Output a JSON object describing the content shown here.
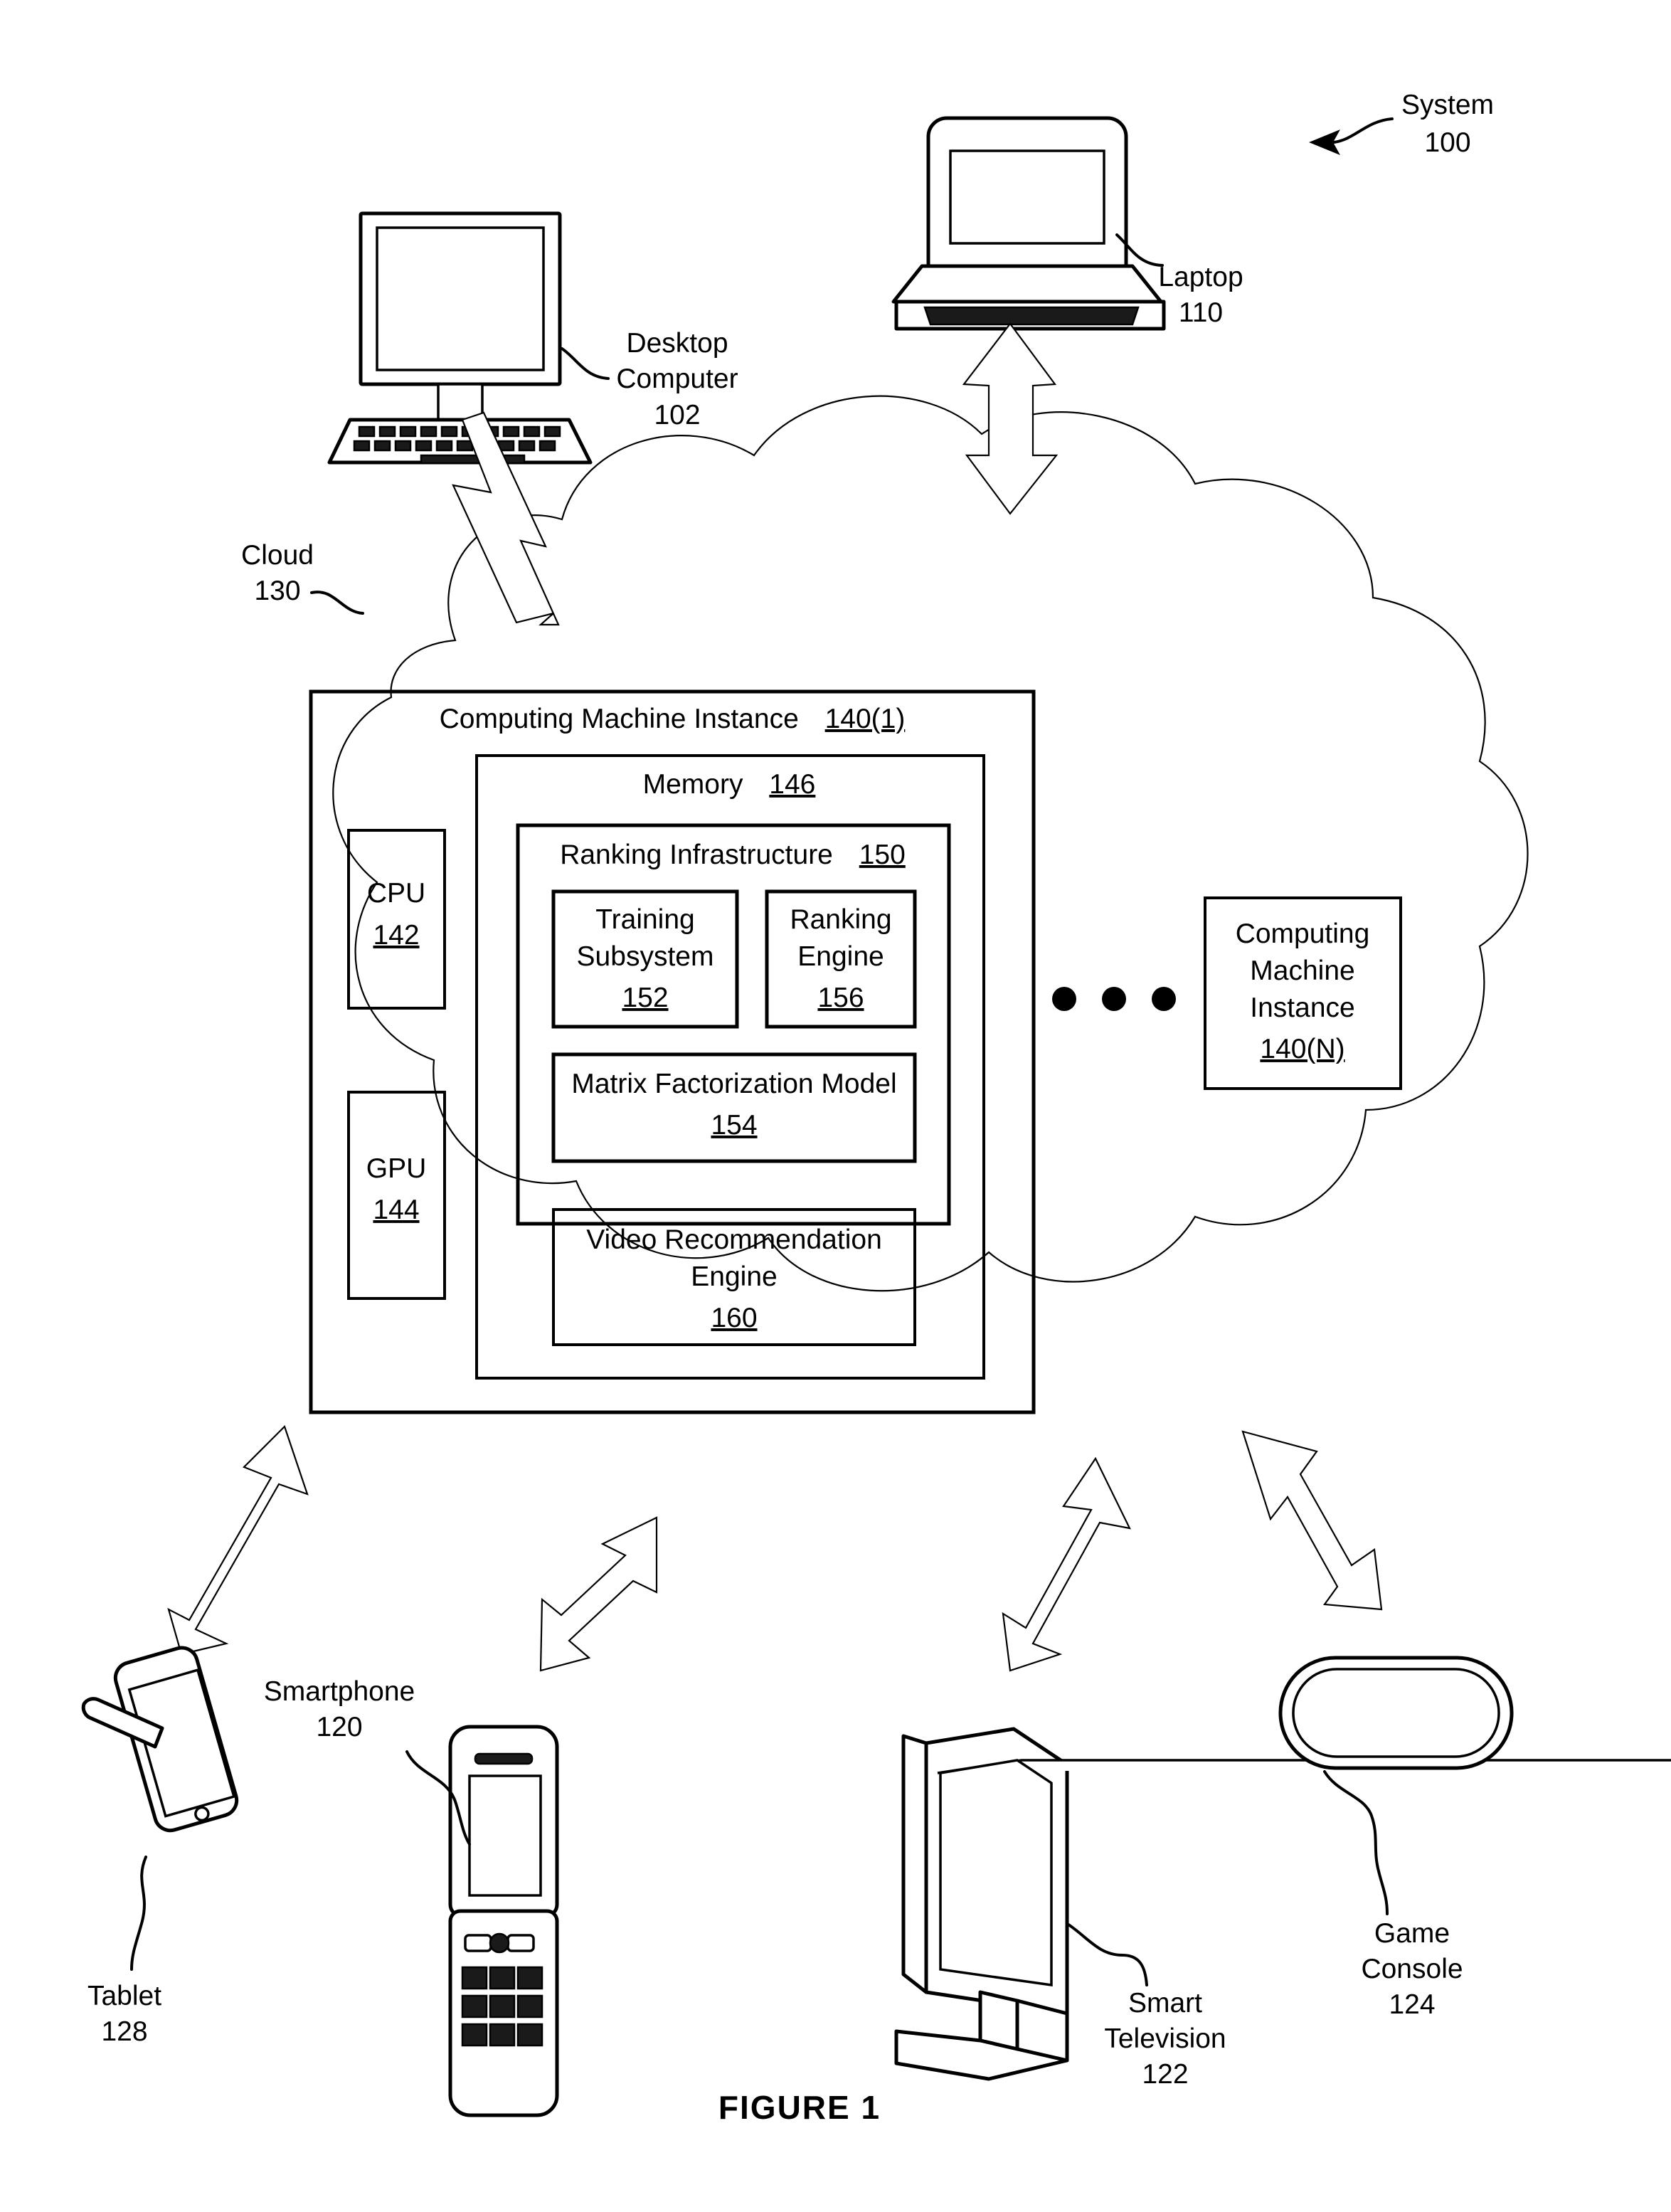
{
  "figure": {
    "caption": "FIGURE 1",
    "system_label": "System",
    "system_ref": "100",
    "cloud_label": "Cloud",
    "cloud_ref": "130"
  },
  "devices": [
    {
      "id": "desktop-computer",
      "label": "Desktop",
      "label2": "Computer",
      "ref": "102"
    },
    {
      "id": "laptop",
      "label": "Laptop",
      "label2": "",
      "ref": "110"
    },
    {
      "id": "tablet",
      "label": "Tablet",
      "label2": "",
      "ref": "128"
    },
    {
      "id": "smartphone",
      "label": "Smartphone",
      "label2": "",
      "ref": "120"
    },
    {
      "id": "smart-television",
      "label": "Smart",
      "label2": "Television",
      "ref": "122"
    },
    {
      "id": "game-console",
      "label": "Game",
      "label2": "Console",
      "ref": "124"
    }
  ],
  "computing_machine_instance": {
    "title": "Computing Machine Instance",
    "ref": "140(1)",
    "cpu": {
      "title": "CPU",
      "ref": "142"
    },
    "gpu": {
      "title": "GPU",
      "ref": "144"
    },
    "memory": {
      "title": "Memory",
      "ref": "146"
    },
    "ranking_infrastructure": {
      "title": "Ranking Infrastructure",
      "ref": "150"
    },
    "training_subsystem": {
      "title_line1": "Training",
      "title_line2": "Subsystem",
      "ref": "152"
    },
    "ranking_engine": {
      "title_line1": "Ranking",
      "title_line2": "Engine",
      "ref": "156"
    },
    "matrix_factorization_model": {
      "title": "Matrix Factorization Model",
      "ref": "154"
    },
    "video_recommendation_engine": {
      "title_line1": "Video Recommendation",
      "title_line2": "Engine",
      "ref": "160"
    }
  },
  "computing_machine_instance_n": {
    "title_line1": "Computing",
    "title_line2": "Machine",
    "title_line3": "Instance",
    "ref": "140(N)"
  },
  "ellipsis": "● ● ●",
  "colors": {
    "stroke": "#000000",
    "fill": "#ffffff"
  }
}
